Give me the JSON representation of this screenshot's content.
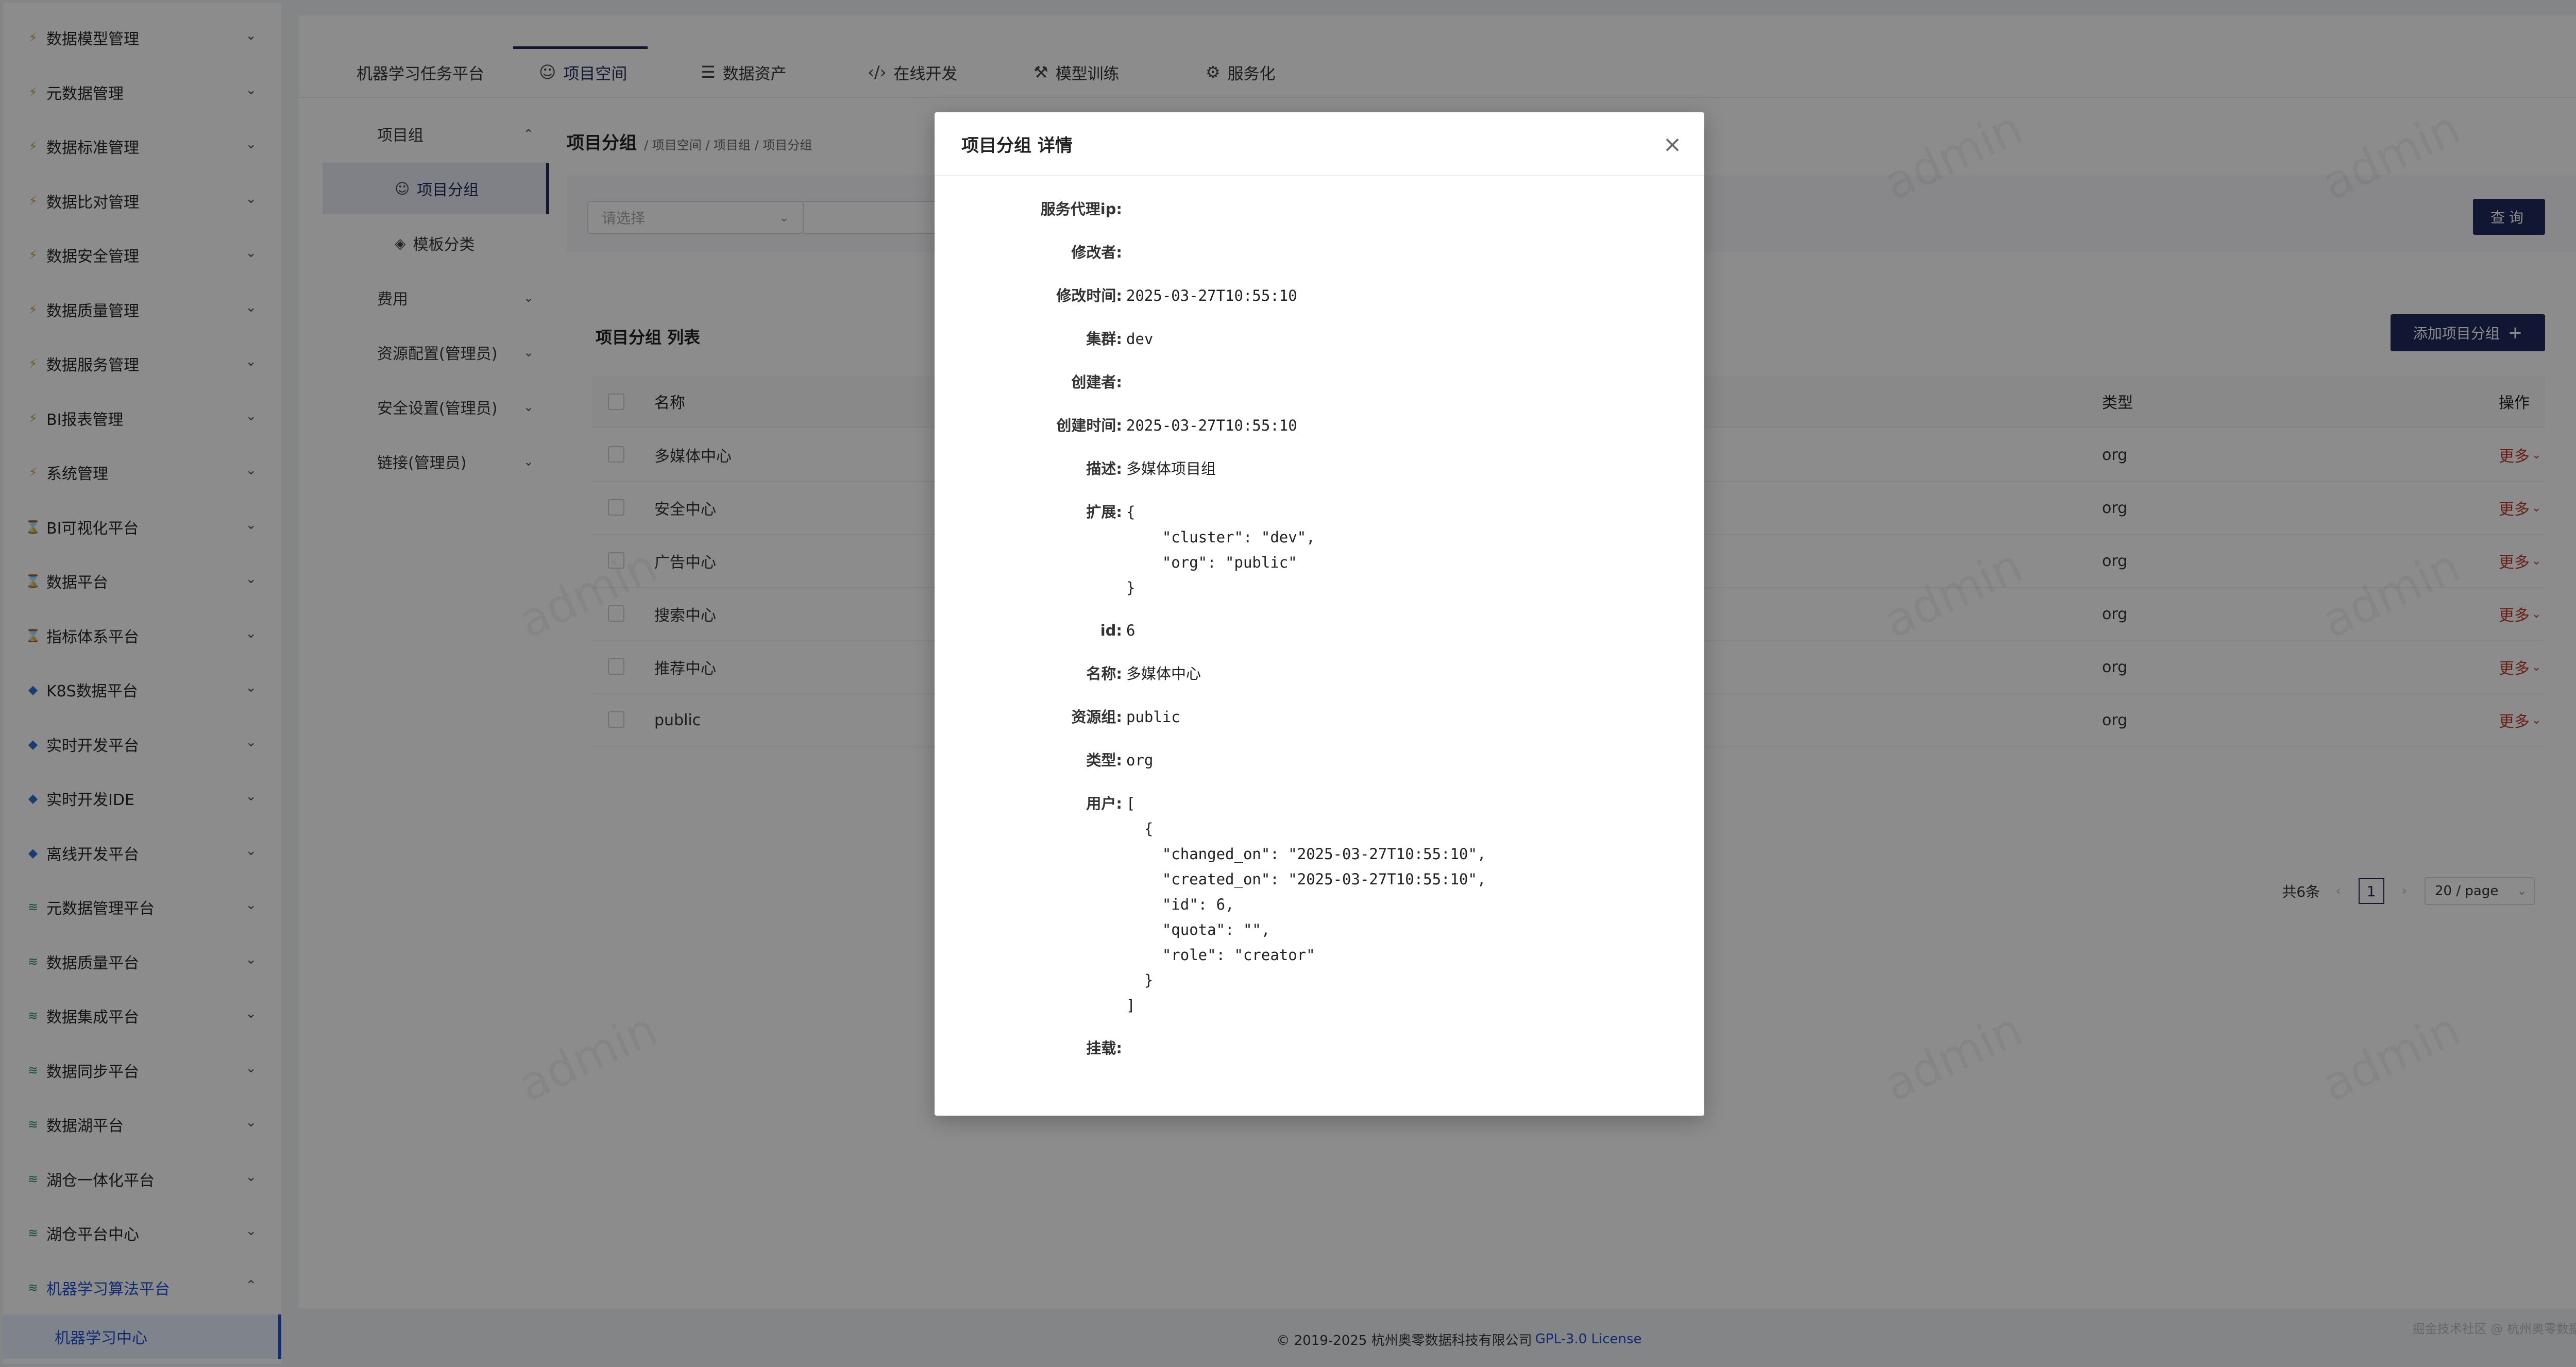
{
  "sidebar": {
    "items": [
      {
        "label": "数据模型管理",
        "icon": "bolt-icon"
      },
      {
        "label": "元数据管理",
        "icon": "bolt-icon"
      },
      {
        "label": "数据标准管理",
        "icon": "bolt-icon"
      },
      {
        "label": "数据比对管理",
        "icon": "bolt-icon"
      },
      {
        "label": "数据安全管理",
        "icon": "bolt-icon"
      },
      {
        "label": "数据质量管理",
        "icon": "bolt-icon"
      },
      {
        "label": "数据服务管理",
        "icon": "bolt-icon"
      },
      {
        "label": "BI报表管理",
        "icon": "bolt-icon"
      },
      {
        "label": "系统管理",
        "icon": "bolt-icon"
      },
      {
        "label": "BI可视化平台",
        "icon": "hourglass-icon"
      },
      {
        "label": "数据平台",
        "icon": "hourglass-icon"
      },
      {
        "label": "指标体系平台",
        "icon": "hourglass-icon"
      },
      {
        "label": "K8S数据平台",
        "icon": "diamond-icon"
      },
      {
        "label": "实时开发平台",
        "icon": "diamond-icon"
      },
      {
        "label": "实时开发IDE",
        "icon": "diamond-icon"
      },
      {
        "label": "离线开发平台",
        "icon": "diamond-icon"
      },
      {
        "label": "元数据管理平台",
        "icon": "layers-icon"
      },
      {
        "label": "数据质量平台",
        "icon": "layers-icon"
      },
      {
        "label": "数据集成平台",
        "icon": "layers-icon"
      },
      {
        "label": "数据同步平台",
        "icon": "layers-icon"
      },
      {
        "label": "数据湖平台",
        "icon": "layers-icon"
      },
      {
        "label": "湖仓一体化平台",
        "icon": "layers-icon"
      },
      {
        "label": "湖仓平台中心",
        "icon": "layers-icon"
      },
      {
        "label": "机器学习算法平台",
        "icon": "layers-icon"
      }
    ],
    "active_sub": "机器学习中心"
  },
  "topnav": {
    "tabs": [
      {
        "label": "机器学习任务平台"
      },
      {
        "label": "项目空间"
      },
      {
        "label": "数据资产"
      },
      {
        "label": "在线开发"
      },
      {
        "label": "模型训练"
      },
      {
        "label": "服务化"
      }
    ]
  },
  "submenu": {
    "group": "项目组",
    "subs": [
      "项目分组",
      "模板分类"
    ],
    "others": [
      "费用",
      "资源配置(管理员)",
      "安全设置(管理员)",
      "链接(管理员)"
    ]
  },
  "content": {
    "title": "项目分组",
    "breadcrumb": "/ 项目空间 / 项目组 / 项目分组",
    "filter_placeholder": "请选择",
    "query_label": "查询",
    "list_title": "项目分组 列表",
    "add_label": "添加项目分组",
    "columns": {
      "name": "名称",
      "type": "类型",
      "ops": "操作"
    },
    "rows": [
      {
        "name": "多媒体中心",
        "type": "org",
        "op": "更多"
      },
      {
        "name": "安全中心",
        "type": "org",
        "op": "更多"
      },
      {
        "name": "广告中心",
        "type": "org",
        "op": "更多"
      },
      {
        "name": "搜索中心",
        "type": "org",
        "op": "更多"
      },
      {
        "name": "推荐中心",
        "type": "org",
        "op": "更多"
      },
      {
        "name": "public",
        "type": "org",
        "op": "更多"
      }
    ],
    "pagination": {
      "total": "共6条",
      "page": "1",
      "size": "20 / page"
    }
  },
  "watermark": {
    "text": "admin"
  },
  "footer": {
    "copyright": "© 2019-2025 杭州奥零数据科技有限公司",
    "license": "GPL-3.0 License",
    "credit": "掘金技术社区 @ 杭州奥零数据科技"
  },
  "modal": {
    "title": "项目分组 详情",
    "close": "×",
    "fields": [
      {
        "label": "服务代理ip:",
        "value": ""
      },
      {
        "label": "修改者:",
        "value": ""
      },
      {
        "label": "修改时间:",
        "value": "2025-03-27T10:55:10"
      },
      {
        "label": "集群:",
        "value": "dev"
      },
      {
        "label": "创建者:",
        "value": ""
      },
      {
        "label": "创建时间:",
        "value": "2025-03-27T10:55:10"
      },
      {
        "label": "描述:",
        "value": "多媒体项目组"
      },
      {
        "label": "扩展:",
        "value": "{\n    \"cluster\": \"dev\",\n    \"org\": \"public\"\n}"
      },
      {
        "label": "id:",
        "value": "6"
      },
      {
        "label": "名称:",
        "value": "多媒体中心"
      },
      {
        "label": "资源组:",
        "value": "public"
      },
      {
        "label": "类型:",
        "value": "org"
      },
      {
        "label": "用户:",
        "value": "[\n  {\n    \"changed_on\": \"2025-03-27T10:55:10\",\n    \"created_on\": \"2025-03-27T10:55:10\",\n    \"id\": 6,\n    \"quota\": \"\",\n    \"role\": \"creator\"\n  }\n]"
      },
      {
        "label": "挂载:",
        "value": ""
      }
    ]
  }
}
